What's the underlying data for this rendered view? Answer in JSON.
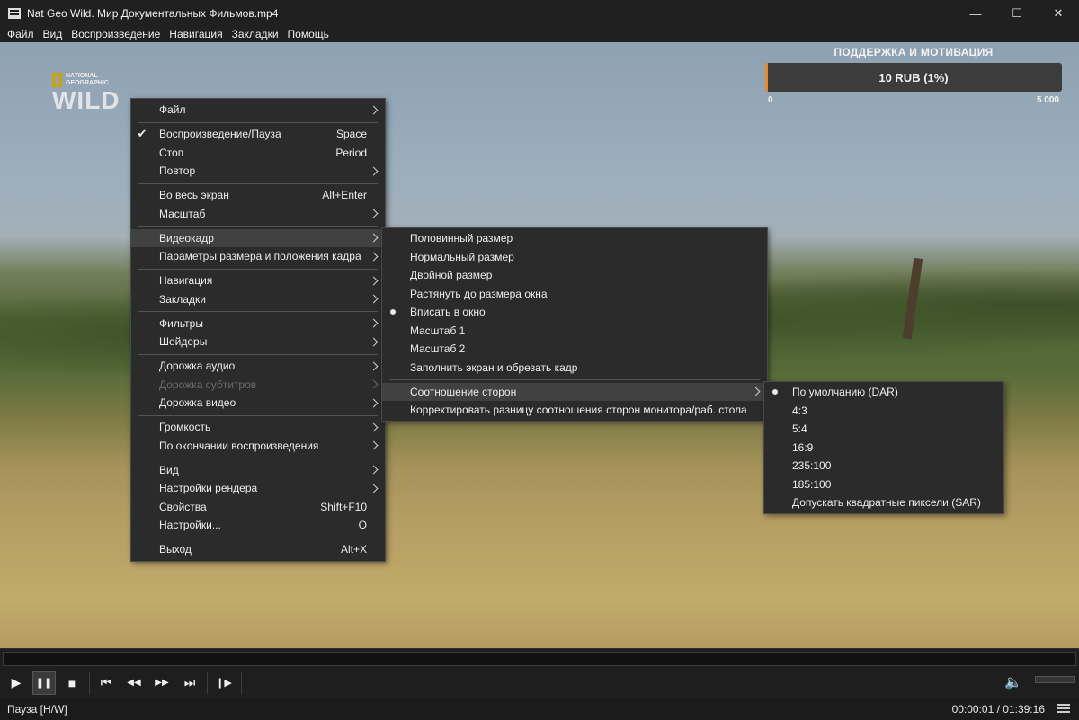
{
  "window": {
    "title": "Nat Geo Wild. Мир Документальных Фильмов.mp4",
    "minimize": "—",
    "maximize": "☐",
    "close": "✕"
  },
  "menubar": [
    "Файл",
    "Вид",
    "Воспроизведение",
    "Навигация",
    "Закладки",
    "Помощь"
  ],
  "video": {
    "logo_small": "NATIONAL\nGEOGRAPHIC",
    "logo_big": "WILD",
    "donation": {
      "title": "ПОДДЕРЖКА И МОТИВАЦИЯ",
      "amount": "10 RUB (1%)",
      "progress_fraction": 0.01,
      "scale_min": "0",
      "scale_max": "5 000",
      "accent": "#e8892a"
    }
  },
  "context_menu": {
    "items": [
      {
        "label": "Файл",
        "submenu": true
      },
      {
        "sep": true
      },
      {
        "label": "Воспроизведение/Пауза",
        "shortcut": "Space",
        "checked": true
      },
      {
        "label": "Стоп",
        "shortcut": "Period"
      },
      {
        "label": "Повтор",
        "submenu": true
      },
      {
        "sep": true
      },
      {
        "label": "Во весь экран",
        "shortcut": "Alt+Enter"
      },
      {
        "label": "Масштаб",
        "submenu": true
      },
      {
        "sep": true
      },
      {
        "label": "Видеокадр",
        "submenu": true,
        "selected": true
      },
      {
        "label": "Параметры размера и положения кадра",
        "submenu": true
      },
      {
        "sep": true
      },
      {
        "label": "Навигация",
        "submenu": true
      },
      {
        "label": "Закладки",
        "submenu": true
      },
      {
        "sep": true
      },
      {
        "label": "Фильтры",
        "submenu": true
      },
      {
        "label": "Шейдеры",
        "submenu": true
      },
      {
        "sep": true
      },
      {
        "label": "Дорожка аудио",
        "submenu": true
      },
      {
        "label": "Дорожка субтитров",
        "submenu": true,
        "disabled": true
      },
      {
        "label": "Дорожка видео",
        "submenu": true
      },
      {
        "sep": true
      },
      {
        "label": "Громкость",
        "submenu": true
      },
      {
        "label": "По окончании воспроизведения",
        "submenu": true
      },
      {
        "sep": true
      },
      {
        "label": "Вид",
        "submenu": true
      },
      {
        "label": "Настройки рендера",
        "submenu": true
      },
      {
        "label": "Свойства",
        "shortcut": "Shift+F10"
      },
      {
        "label": "Настройки...",
        "shortcut": "O"
      },
      {
        "sep": true
      },
      {
        "label": "Выход",
        "shortcut": "Alt+X"
      }
    ]
  },
  "videoframe_menu": {
    "items": [
      {
        "label": "Половинный размер"
      },
      {
        "label": "Нормальный размер"
      },
      {
        "label": "Двойной размер"
      },
      {
        "label": "Растянуть до размера окна"
      },
      {
        "label": "Вписать в окно",
        "radio": true
      },
      {
        "label": "Масштаб 1"
      },
      {
        "label": "Масштаб 2"
      },
      {
        "label": "Заполнить экран и обрезать кадр"
      },
      {
        "sep": true
      },
      {
        "label": "Соотношение сторон",
        "submenu": true,
        "selected": true
      },
      {
        "label": "Корректировать разницу соотношения сторон монитора/раб. стола"
      }
    ]
  },
  "aspect_menu": {
    "items": [
      {
        "label": "По умолчанию (DAR)",
        "radio": true
      },
      {
        "label": "4:3"
      },
      {
        "label": "5:4"
      },
      {
        "label": "16:9"
      },
      {
        "label": "235:100"
      },
      {
        "label": "185:100"
      },
      {
        "label": "Допускать квадратные пиксели (SAR)"
      }
    ]
  },
  "seek": {
    "position_fraction": 0.0002
  },
  "controls": {
    "play": "▶",
    "pause": "❚❚",
    "stop": "■",
    "prev": "⏮",
    "rewind": "◀◀",
    "forward": "▶▶",
    "next": "⏭",
    "frame_step": "❙▶",
    "volume_icon": "🔈",
    "volume_fraction": 0.0
  },
  "status": {
    "state": "Пауза [H/W]",
    "time": "00:00:01 / 01:39:16"
  }
}
